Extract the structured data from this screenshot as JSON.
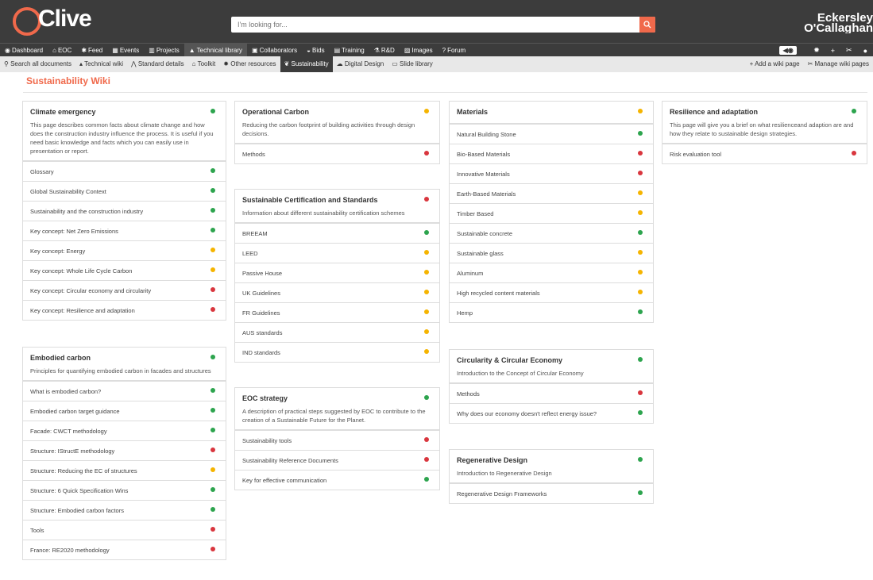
{
  "app": {
    "logo": "Clive",
    "brand_line1": "Eckersley",
    "brand_line2": "O'Callaghan"
  },
  "search": {
    "placeholder": "I'm looking for..."
  },
  "nav": {
    "items": [
      "Dashboard",
      "EOC",
      "Feed",
      "Events",
      "Projects",
      "Technical library",
      "Collaborators",
      "Bids",
      "Training",
      "R&D",
      "Images",
      "Forum"
    ],
    "active": "Technical library"
  },
  "subnav": {
    "items": [
      "Search all documents",
      "Technical wiki",
      "Standard details",
      "Toolkit",
      "Other resources",
      "Sustainability",
      "Digital Design",
      "Slide library"
    ],
    "active": "Sustainability",
    "right": [
      "Add a wiki page",
      "Manage wiki pages"
    ]
  },
  "page": {
    "title": "Sustainability Wiki"
  },
  "colors": {
    "accent": "#f0694b",
    "green": "#2da44e",
    "yellow": "#f5b400",
    "red": "#d9363e"
  },
  "cards": [
    {
      "title": "Climate emergency",
      "status": "green",
      "desc": "This page describes common facts about climate change and how does the construction industry influence the process. It is useful if you need basic knowledge and facts which you can easily use in presentation or report.",
      "items": [
        {
          "label": "Glossary",
          "status": "green"
        },
        {
          "label": "Global Sustainability Context",
          "status": "green"
        },
        {
          "label": "Sustainability and the construction industry",
          "status": "green"
        },
        {
          "label": "Key concept: Net Zero Emissions",
          "status": "green"
        },
        {
          "label": "Key concept: Energy",
          "status": "yellow"
        },
        {
          "label": "Key concept: Whole Life Cycle Carbon",
          "status": "yellow"
        },
        {
          "label": "Key concept: Circular economy and circularity",
          "status": "red"
        },
        {
          "label": "Key concept: Resilience and adaptation",
          "status": "red"
        }
      ]
    },
    {
      "title": "Embodied carbon",
      "status": "green",
      "desc": "Principles for quantifying embodied carbon in facades and structures",
      "items": [
        {
          "label": "What is embodied carbon?",
          "status": "green"
        },
        {
          "label": "Embodied carbon target guidance",
          "status": "green"
        },
        {
          "label": "Facade: CWCT methodology",
          "status": "green"
        },
        {
          "label": "Structure: IStructE methodology",
          "status": "red"
        },
        {
          "label": "Structure: Reducing the EC of structures",
          "status": "yellow"
        },
        {
          "label": "Structure: 6 Quick Specification Wins",
          "status": "green"
        },
        {
          "label": "Structure: Embodied carbon factors",
          "status": "green"
        },
        {
          "label": "Tools",
          "status": "red"
        },
        {
          "label": "France: RE2020 methodology",
          "status": "red"
        }
      ]
    },
    {
      "title": "Operational Carbon",
      "status": "yellow",
      "desc": "Reducing the carbon footprint of building activities through design decisions.",
      "items": [
        {
          "label": "Methods",
          "status": "red"
        }
      ]
    },
    {
      "title": "Sustainable Certification and Standards",
      "status": "red",
      "desc": "Information about different sustainability certification schemes",
      "items": [
        {
          "label": "BREEAM",
          "status": "green"
        },
        {
          "label": "LEED",
          "status": "yellow"
        },
        {
          "label": "Passive House",
          "status": "yellow"
        },
        {
          "label": "UK Guidelines",
          "status": "yellow"
        },
        {
          "label": "FR Guidelines",
          "status": "yellow"
        },
        {
          "label": "AUS standards",
          "status": "yellow"
        },
        {
          "label": "IND standards",
          "status": "yellow"
        }
      ]
    },
    {
      "title": "EOC strategy",
      "status": "green",
      "desc": "A description of practical steps suggested by EOC to contribute to the creation of a Sustainable Future for the Planet.",
      "items": [
        {
          "label": "Sustainability tools",
          "status": "red"
        },
        {
          "label": "Sustainability Reference Documents",
          "status": "red"
        },
        {
          "label": "Key for effective communication",
          "status": "green"
        }
      ]
    },
    {
      "title": "Materials",
      "status": "yellow",
      "desc": "",
      "items": [
        {
          "label": "Natural Building Stone",
          "status": "green"
        },
        {
          "label": "Bio-Based Materials",
          "status": "red"
        },
        {
          "label": "Innovative Materials",
          "status": "red"
        },
        {
          "label": "Earth-Based Materials",
          "status": "yellow"
        },
        {
          "label": "Timber Based",
          "status": "yellow"
        },
        {
          "label": "Sustainable concrete",
          "status": "green"
        },
        {
          "label": "Sustainable glass",
          "status": "yellow"
        },
        {
          "label": "Aluminum",
          "status": "yellow"
        },
        {
          "label": "High recycled content materials",
          "status": "yellow"
        },
        {
          "label": "Hemp",
          "status": "green"
        }
      ]
    },
    {
      "title": "Circularity & Circular Economy",
      "status": "green",
      "desc": "Introduction to the Concept of Circular Economy",
      "items": [
        {
          "label": "Methods",
          "status": "red"
        },
        {
          "label": "Why does our economy doesn't reflect energy issue?",
          "status": "green"
        }
      ]
    },
    {
      "title": "Regenerative Design",
      "status": "green",
      "desc": "Introduction to Regenerative Design",
      "items": [
        {
          "label": "Regenerative Design Frameworks",
          "status": "green"
        }
      ]
    },
    {
      "title": "Resilience and adaptation",
      "status": "green",
      "desc": "This page will give you a brief on what resilienceand adaption are and how they relate to sustainable design strategies.",
      "items": [
        {
          "label": "Risk evaluation tool",
          "status": "red"
        }
      ]
    }
  ]
}
